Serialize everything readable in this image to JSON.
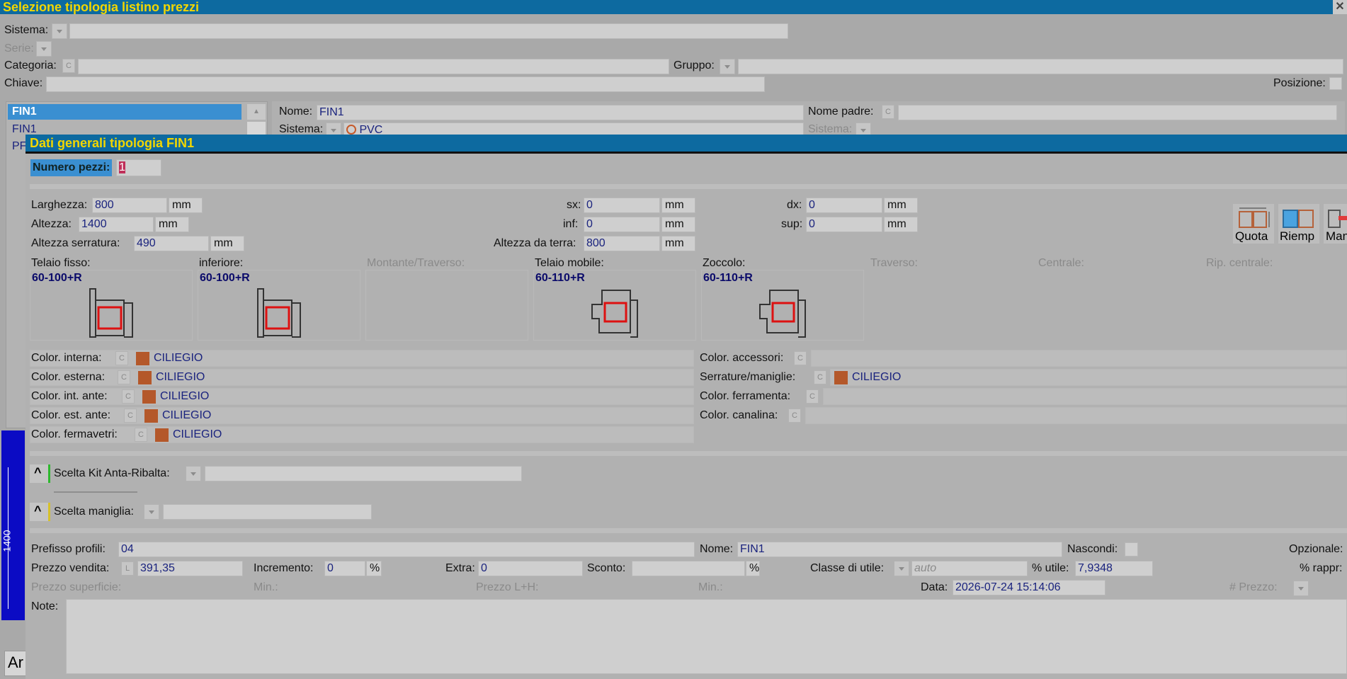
{
  "back_window": {
    "title": "Selezione tipologia listino prezzi",
    "sistema_label": "Sistema:",
    "serie_label": "Serie:",
    "categoria_label": "Categoria:",
    "gruppo_label": "Gruppo:",
    "chiave_label": "Chiave:",
    "posizione_label": "Posizione:",
    "c_btn": "C",
    "list_items": [
      "FIN1",
      "FIN1",
      "PF"
    ],
    "nome_label": "Nome:",
    "nome_value": "FIN1",
    "nome_padre_label": "Nome padre:",
    "sistema2_label": "Sistema:",
    "sistema2_value": "PVC",
    "sistema3_label": "Sistema:",
    "preview_height": "1400",
    "bottom_btn": "Ar"
  },
  "dialog": {
    "title": "Dati generali tipologia FIN1",
    "numero_pezzi_label": "Numero pezzi:",
    "numero_pezzi_value": "1",
    "larghezza_label": "Larghezza:",
    "larghezza_value": "800",
    "altezza_label": "Altezza:",
    "altezza_value": "1400",
    "altezza_serratura_label": "Altezza serratura:",
    "altezza_serratura_value": "490",
    "unit_mm": "mm",
    "sx_label": "sx:",
    "sx_value": "0",
    "inf_label": "inf:",
    "inf_value": "0",
    "altezza_terra_label": "Altezza da terra:",
    "altezza_terra_value": "800",
    "dx_label": "dx:",
    "dx_value": "0",
    "sup_label": "sup:",
    "sup_value": "0",
    "toolbar": {
      "quota": "Quota",
      "riemp": "Riemp",
      "man": "Man"
    },
    "profiles": [
      {
        "label": "Telaio fisso:",
        "code": "60-100+R",
        "enabled": true
      },
      {
        "label": "inferiore:",
        "code": "60-100+R",
        "enabled": true
      },
      {
        "label": "Montante/Traverso:",
        "code": "",
        "enabled": false
      },
      {
        "label": "Telaio mobile:",
        "code": "60-110+R",
        "enabled": true
      },
      {
        "label": "Zoccolo:",
        "code": "60-110+R",
        "enabled": true
      },
      {
        "label": "Traverso:",
        "code": "",
        "enabled": false
      },
      {
        "label": "Centrale:",
        "code": "",
        "enabled": false
      },
      {
        "label": "Rip. centrale:",
        "code": "",
        "enabled": false
      }
    ],
    "colors_left": [
      {
        "label": "Color. interna:",
        "value": "CILIEGIO"
      },
      {
        "label": "Color. esterna:",
        "value": "CILIEGIO"
      },
      {
        "label": "Color. int. ante:",
        "value": "CILIEGIO"
      },
      {
        "label": "Color. est. ante:",
        "value": "CILIEGIO"
      },
      {
        "label": "Color. fermavetri:",
        "value": "CILIEGIO"
      }
    ],
    "colors_right": [
      {
        "label": "Color. accessori:",
        "value": ""
      },
      {
        "label": "Serrature/maniglie:",
        "value": "CILIEGIO"
      },
      {
        "label": "Color. ferramenta:",
        "value": ""
      },
      {
        "label": "Color. canalina:",
        "value": ""
      }
    ],
    "swatch_color": "#b4582a",
    "kit_label": "Scelta Kit Anta-Ribalta:",
    "maniglia_label": "Scelta maniglia:",
    "prefisso_label": "Prefisso profili:",
    "prefisso_value": "04",
    "nome_label": "Nome:",
    "nome_value": "FIN1",
    "nascondi_label": "Nascondi:",
    "opzionale_label": "Opzionale:",
    "prezzo_vendita_label": "Prezzo vendita:",
    "prezzo_vendita_btn": "L",
    "prezzo_vendita_value": "391,35",
    "incremento_label": "Incremento:",
    "incremento_value": "0",
    "percent": "%",
    "extra_label": "Extra:",
    "extra_value": "0",
    "sconto_label": "Sconto:",
    "sconto_value": "",
    "classe_label": "Classe di utile:",
    "classe_placeholder": "auto",
    "utile_label": "% utile:",
    "utile_value": "7,9348",
    "rappr_label": "% rappr:",
    "prezzo_superficie_label": "Prezzo superficie:",
    "min_label": "Min.:",
    "prezzo_lh_label": "Prezzo L+H:",
    "min2_label": "Min.:",
    "data_label": "Data:",
    "data_value": "2026-07-24 15:14:06",
    "num_prezzo_label": "# Prezzo:",
    "note_label": "Note:"
  },
  "colors": {
    "title_bg": "#0d6aa0",
    "title_fg": "#f2d600",
    "value_fg": "#1a237e",
    "selection": "#3a8fd1"
  }
}
